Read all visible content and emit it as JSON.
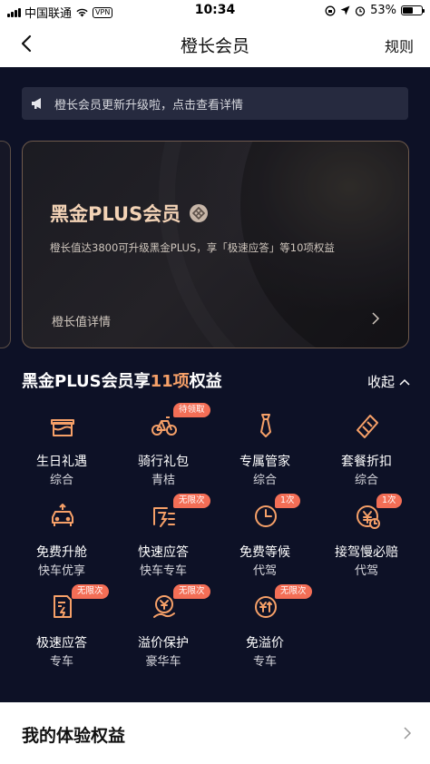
{
  "status": {
    "carrier": "中国联通",
    "vpn": "VPN",
    "time": "10:34",
    "battery": "53%",
    "battery_level": 0.53
  },
  "nav": {
    "title": "橙长会员",
    "rules": "规则"
  },
  "notice": {
    "text": "橙长会员更新升级啦，点击查看详情"
  },
  "card": {
    "name": "黑金PLUS会员",
    "desc": "橙长值达3800可升级黑金PLUS，享「极速应答」等10项权益",
    "detail": "橙长值详情"
  },
  "section": {
    "title_pre": "黑金PLUS会员享",
    "title_count": "11项",
    "title_post": "权益",
    "collapse": "收起"
  },
  "benefits": [
    {
      "icon": "cake-icon",
      "title": "生日礼遇",
      "sub": "综合",
      "tag": ""
    },
    {
      "icon": "bike-icon",
      "title": "骑行礼包",
      "sub": "青桔",
      "tag": "待领取"
    },
    {
      "icon": "tie-icon",
      "title": "专属管家",
      "sub": "综合",
      "tag": ""
    },
    {
      "icon": "ticket-icon",
      "title": "套餐折扣",
      "sub": "综合",
      "tag": ""
    },
    {
      "icon": "car-upgrade-icon",
      "title": "免费升舱",
      "sub": "快车优享",
      "tag": ""
    },
    {
      "icon": "fast-response-icon",
      "title": "快速应答",
      "sub": "快车专车",
      "tag": "无限次"
    },
    {
      "icon": "clock-icon",
      "title": "免费等候",
      "sub": "代驾",
      "tag": "1次"
    },
    {
      "icon": "compensation-icon",
      "title": "接驾慢必赔",
      "sub": "代驾",
      "tag": "1次"
    },
    {
      "icon": "speed-document-icon",
      "title": "极速应答",
      "sub": "专车",
      "tag": "无限次"
    },
    {
      "icon": "price-protect-icon",
      "title": "溢价保护",
      "sub": "豪华车",
      "tag": "无限次"
    },
    {
      "icon": "no-surcharge-icon",
      "title": "免溢价",
      "sub": "专车",
      "tag": "无限次"
    }
  ],
  "bottom": {
    "title": "我的体验权益"
  },
  "colors": {
    "accent": "#f6a068",
    "tag": "#f36e56",
    "background": "#0d1126",
    "gold_text": "#f3d3b6"
  }
}
